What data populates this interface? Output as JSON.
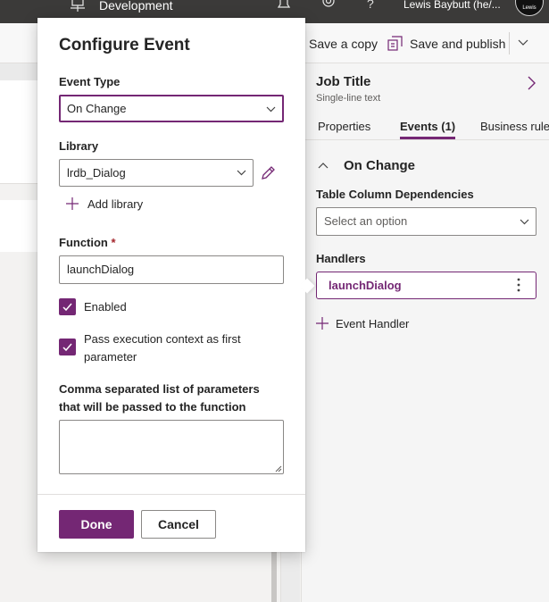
{
  "topbar": {
    "environment_label": "Development",
    "environment_icon": "environment-icon",
    "notifications_icon": "bell-icon",
    "settings_icon": "gear-icon",
    "help_label": "?",
    "user_name": "Lewis Baybutt (he/...",
    "avatar_text": "Lewis",
    "background": "#3b3a39"
  },
  "commandbar": {
    "save_copy_label": "Save a copy",
    "save_publish_label": "Save and publish"
  },
  "properties_panel": {
    "title": "Job Title",
    "subtitle": "Single-line text",
    "tabs": [
      {
        "label": "Properties"
      },
      {
        "label": "Events (1)"
      },
      {
        "label": "Business rule"
      }
    ],
    "active_tab": "Events (1)",
    "event_section_title": "On Change",
    "dependencies_label": "Table Column Dependencies",
    "dependencies_placeholder": "Select an option",
    "handlers_label": "Handlers",
    "handler_name": "launchDialog",
    "add_handler_label": "Event Handler"
  },
  "dialog": {
    "title": "Configure Event",
    "event_type_label": "Event Type",
    "event_type_value": "On Change",
    "library_label": "Library",
    "library_value": "lrdb_Dialog",
    "add_library_label": "Add library",
    "function_label": "Function",
    "required_marker": "*",
    "function_value": "launchDialog",
    "enabled_label": "Enabled",
    "enabled_checked": true,
    "pass_context_label": "Pass execution context as first parameter",
    "pass_context_checked": true,
    "params_label": "Comma separated list of parameters that will be passed to the function",
    "params_value": "",
    "done_label": "Done",
    "cancel_label": "Cancel"
  },
  "colors": {
    "accent": "#742774",
    "required": "#a4262c"
  }
}
